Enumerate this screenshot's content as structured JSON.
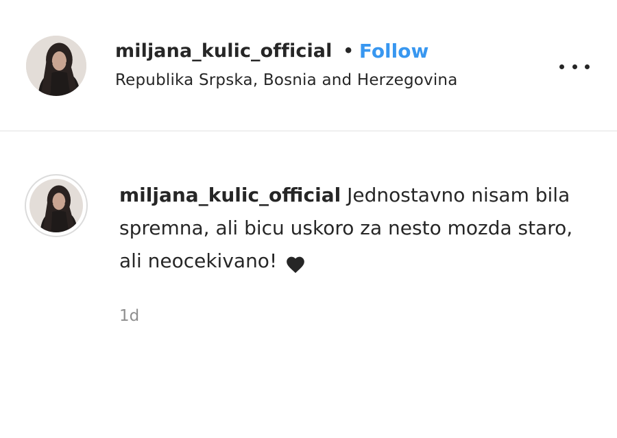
{
  "post_header": {
    "username": "miljana_kulic_official",
    "separator": "•",
    "follow_label": "Follow",
    "location": "Republika Srpska, Bosnia and Herzegovina",
    "more_icon": "more-options-icon"
  },
  "comment": {
    "username": "miljana_kulic_official",
    "text": " Jednostavno nisam bila spremna, ali bicu uskoro za nesto mozda staro, ali neocekivano! ",
    "emoji_icon": "black-heart-icon",
    "timestamp": "1d"
  },
  "colors": {
    "link_blue": "#3897f0",
    "text": "#262626",
    "muted": "#8e8e8e",
    "divider": "#efefef"
  }
}
